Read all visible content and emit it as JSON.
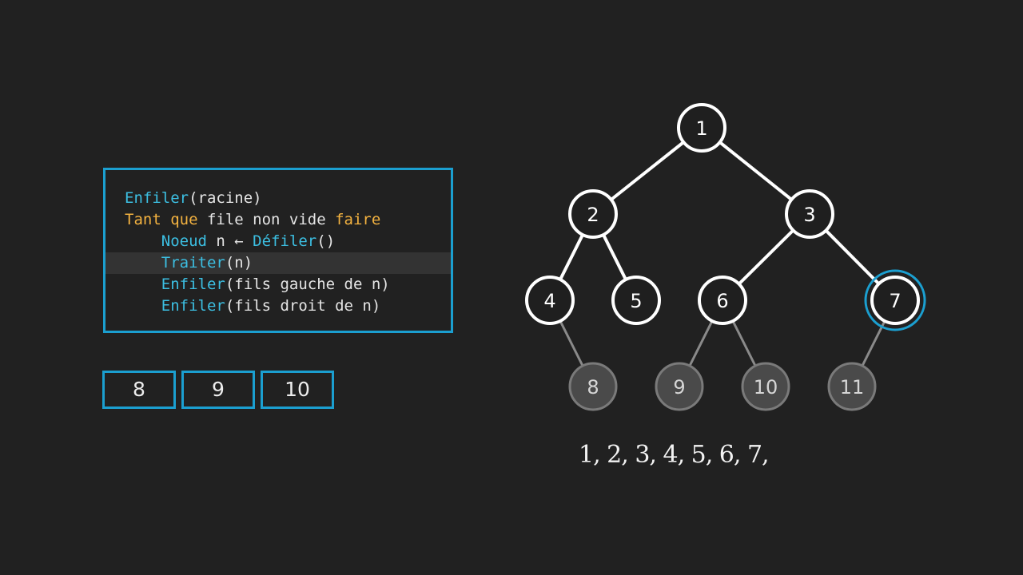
{
  "code": {
    "lines": [
      {
        "tokens": [
          {
            "t": "Enfiler",
            "k": "fn"
          },
          {
            "t": "(racine)",
            "k": "tx"
          }
        ]
      },
      {
        "tokens": [
          {
            "t": "Tant que",
            "k": "kw"
          },
          {
            "t": " file non vide ",
            "k": "tx"
          },
          {
            "t": "faire",
            "k": "kw"
          }
        ]
      },
      {
        "tokens": [
          {
            "t": "    ",
            "k": "tx"
          },
          {
            "t": "Noeud",
            "k": "fn"
          },
          {
            "t": " n ← ",
            "k": "tx"
          },
          {
            "t": "Défiler",
            "k": "fn"
          },
          {
            "t": "()",
            "k": "tx"
          }
        ]
      },
      {
        "tokens": [
          {
            "t": "    ",
            "k": "tx"
          },
          {
            "t": "Traiter",
            "k": "fn"
          },
          {
            "t": "(n)",
            "k": "tx"
          }
        ]
      },
      {
        "tokens": [
          {
            "t": "    ",
            "k": "tx"
          },
          {
            "t": "Enfiler",
            "k": "fn"
          },
          {
            "t": "(fils gauche de n)",
            "k": "tx"
          }
        ]
      },
      {
        "tokens": [
          {
            "t": "    ",
            "k": "tx"
          },
          {
            "t": "Enfiler",
            "k": "fn"
          },
          {
            "t": "(fils droit de n)",
            "k": "tx"
          }
        ]
      }
    ],
    "active_line": 3
  },
  "queue": [
    "8",
    "9",
    "10"
  ],
  "tree": {
    "nodes": [
      {
        "id": "1",
        "state": "visited"
      },
      {
        "id": "2",
        "state": "visited"
      },
      {
        "id": "3",
        "state": "visited"
      },
      {
        "id": "4",
        "state": "visited"
      },
      {
        "id": "5",
        "state": "visited"
      },
      {
        "id": "6",
        "state": "visited"
      },
      {
        "id": "7",
        "state": "current"
      },
      {
        "id": "8",
        "state": "queued"
      },
      {
        "id": "9",
        "state": "queued"
      },
      {
        "id": "10",
        "state": "queued"
      },
      {
        "id": "11",
        "state": "queued"
      }
    ],
    "edges": [
      [
        "1",
        "2"
      ],
      [
        "1",
        "3"
      ],
      [
        "2",
        "4"
      ],
      [
        "2",
        "5"
      ],
      [
        "3",
        "6"
      ],
      [
        "3",
        "7"
      ],
      [
        "4",
        "8"
      ],
      [
        "6",
        "9"
      ],
      [
        "6",
        "10"
      ],
      [
        "7",
        "11"
      ]
    ]
  },
  "output": "1, 2, 3, 4, 5, 6, 7,",
  "colors": {
    "background": "#212121",
    "accent": "#1b9fd0",
    "keyword": "#f3b240",
    "function": "#3cbfe2",
    "node_fill": "#1f1f1f",
    "node_stroke": "#ffffff",
    "queued_fill": "#4a4a4a",
    "queued_stroke": "#7a7a7a"
  }
}
